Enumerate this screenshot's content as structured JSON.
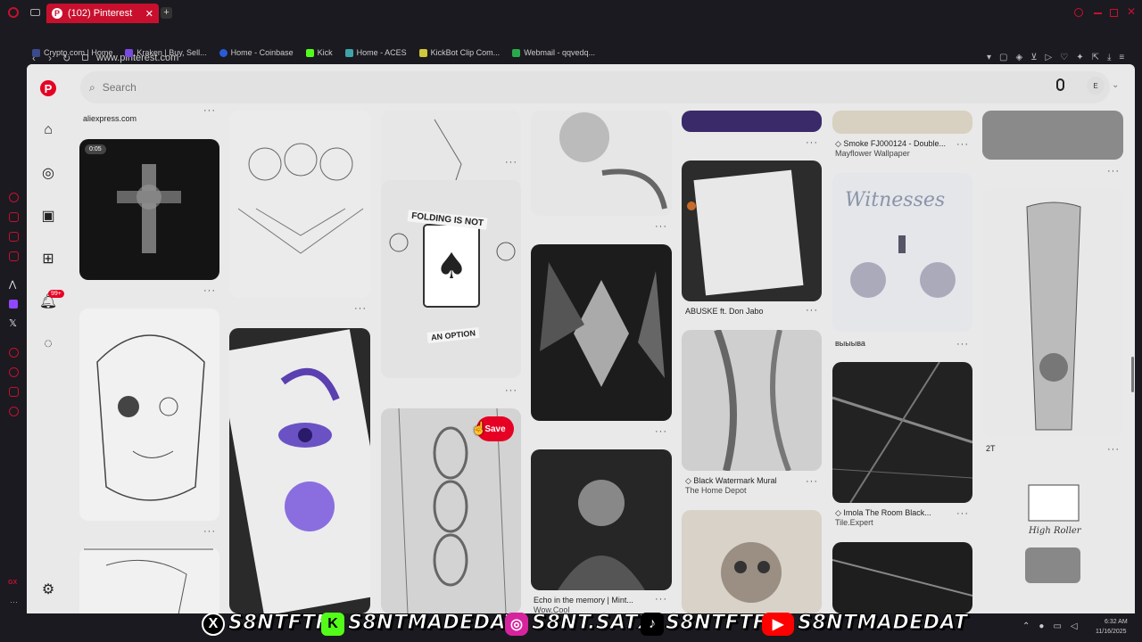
{
  "browser": {
    "tab_title": "(102) Pinterest",
    "url": "www.pinterest.com",
    "bookmarks": [
      {
        "label": "Crypto.com | Home",
        "color": "#3b4a8a"
      },
      {
        "label": "Kraken | Buy, Sell...",
        "color": "#7a4ae0"
      },
      {
        "label": "Home - Coinbase",
        "color": "#2a5bd7"
      },
      {
        "label": "Kick",
        "color": "#53fc18"
      },
      {
        "label": "Home - ACES",
        "color": "#3fa3a8"
      },
      {
        "label": "KickBot Clip Com...",
        "color": "#d2c63a"
      },
      {
        "label": "Webmail - qqvedq...",
        "color": "#2aa84a"
      }
    ]
  },
  "pinterest": {
    "search_placeholder": "Search",
    "notification_count": "99+",
    "avatar_initial": "E",
    "save_button": "Save",
    "accent": "#e60023"
  },
  "pins": {
    "col1_top_caption": "aliexpress.com",
    "cross_duration": "0:05",
    "col4_caption1": "ABUSKE ft. Don Jabo",
    "col4_caption2": "Black Watermark Mural",
    "col4_sub2": "The Home Depot",
    "col5_caption1": "Smoke FJ000124 - Double...",
    "col5_sub1": "Mayflower Wallpaper",
    "col5_caption2": "выыыва",
    "col5_caption3": "Imola The Room Black...",
    "col5_sub3": "Tile.Expert",
    "col5_poster_title": "Witnesses",
    "col6_caption1": "2T",
    "col3_caption": "Echo in the memory | Mint...",
    "col3_sub": "Wow.Cool",
    "folding_text1": "FOLDING IS NOT",
    "folding_text2": "AN OPTION",
    "high_roller": "High Roller"
  },
  "overlay": {
    "handle1": "S8NTFTF",
    "handle2": "S8NTMADEDAT",
    "handle3": "S8NT.SATX",
    "handle4": "S8NTFTF",
    "handle5": "S8NTMADEDAT",
    "time": "6:32 AM",
    "date": "11/16/2025"
  }
}
